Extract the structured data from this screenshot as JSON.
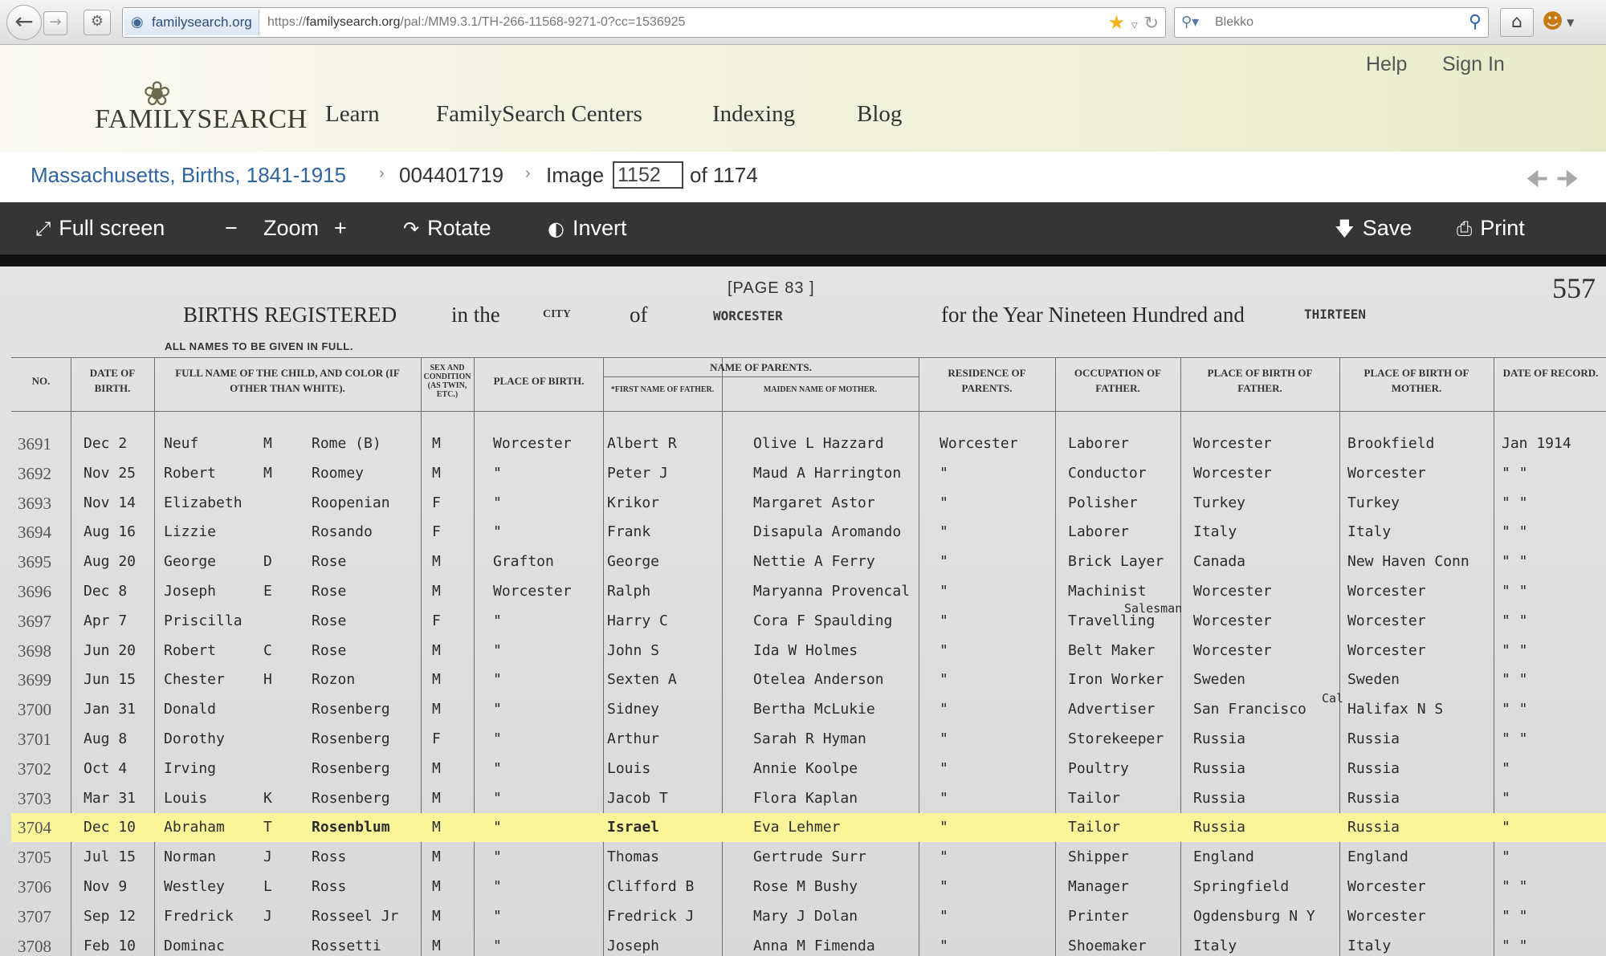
{
  "browser": {
    "site_identity": "familysearch.org",
    "url_prefix": "https://",
    "url_domain": "familysearch.org",
    "url_path": "/pal:/MM9.3.1/TH-266-11568-9271-0?cc=1536925",
    "search_placeholder": "Blekko",
    "icons": {
      "back": "back-arrow-icon",
      "forward": "forward-arrow-icon",
      "star": "bookmark-star-icon",
      "reload": "reload-icon",
      "home": "home-icon"
    }
  },
  "header": {
    "logo": "FAMILYSEARCH",
    "nav": [
      "Learn",
      "FamilySearch Centers",
      "Indexing",
      "Blog"
    ],
    "help": "Help",
    "sign_in": "Sign In"
  },
  "breadcrumb": {
    "collection": "Massachusetts, Births, 1841-1915",
    "film": "004401719",
    "image_label": "Image",
    "image_number": "1152",
    "of_label": "of 1174"
  },
  "toolbar": {
    "full_screen": "Full screen",
    "zoom_minus": "−",
    "zoom": "Zoom",
    "zoom_plus": "+",
    "rotate": "Rotate",
    "invert": "Invert",
    "save": "Save",
    "print": "Print"
  },
  "document": {
    "page_label": "[PAGE 83 ]",
    "page_number": "557",
    "title_part1": "BIRTHS REGISTERED",
    "title_in_the": "in the",
    "title_city": "CITY",
    "title_of": "of",
    "title_place": "WORCESTER",
    "title_year": "for the Year Nineteen Hundred and",
    "title_year_fill": "THIRTEEN",
    "subnote": "ALL NAMES TO BE GIVEN IN FULL.",
    "headers": {
      "no": "No.",
      "date_of_birth": "Date of Birth.",
      "full_name": "Full name of the child, and color (if other than white).",
      "sex": "Sex and condition (as Twin, etc.)",
      "place_of_birth": "Place of Birth.",
      "name_of_parents": "Name of Parents.",
      "father_first": "*First Name of Father.",
      "mother_maiden": "Maiden Name of Mother.",
      "residence": "Residence of Parents.",
      "occupation": "Occupation of Father.",
      "birthplace_father": "Place of Birth of Father.",
      "birthplace_mother": "Place of Birth of Mother.",
      "date_of_record": "Date of Record."
    },
    "rows": [
      {
        "no": "3691",
        "date": "Dec  2",
        "first": "Neuf",
        "mid": "M",
        "last": "Rome    (B)",
        "sex": "M",
        "place": "Worcester",
        "father": "Albert R",
        "mother": "Olive L Hazzard",
        "res": "Worcester",
        "occ": "Laborer",
        "bpf": "Worcester",
        "bpm": "Brookfield",
        "rec": "Jan 1914"
      },
      {
        "no": "3692",
        "date": "Nov 25",
        "first": "Robert",
        "mid": "M",
        "last": "Roomey",
        "sex": "M",
        "place": "\"",
        "father": "Peter J",
        "mother": "Maud A Harrington",
        "res": "\"",
        "occ": "Conductor",
        "bpf": "Worcester",
        "bpm": "Worcester",
        "rec": "\"  \""
      },
      {
        "no": "3693",
        "date": "Nov 14",
        "first": "Elizabeth",
        "mid": "",
        "last": "Roopenian",
        "sex": "F",
        "place": "\"",
        "father": "Krikor",
        "mother": "Margaret Astor",
        "res": "\"",
        "occ": "Polisher",
        "bpf": "Turkey",
        "bpm": "Turkey",
        "rec": "\"  \""
      },
      {
        "no": "3694",
        "date": "Aug 16",
        "first": "Lizzie",
        "mid": "",
        "last": "Rosando",
        "sex": "F",
        "place": "\"",
        "father": "Frank",
        "mother": "Disapula Aromando",
        "res": "\"",
        "occ": "Laborer",
        "bpf": "Italy",
        "bpm": "Italy",
        "rec": "\"  \""
      },
      {
        "no": "3695",
        "date": "Aug 20",
        "first": "George",
        "mid": "D",
        "last": "Rose",
        "sex": "M",
        "place": "Grafton",
        "father": "George",
        "mother": "Nettie A Ferry",
        "res": "\"",
        "occ": "Brick Layer",
        "bpf": "Canada",
        "bpm": "New Haven Conn",
        "rec": "\"  \""
      },
      {
        "no": "3696",
        "date": "Dec  8",
        "first": "Joseph",
        "mid": "E",
        "last": "Rose",
        "sex": "M",
        "place": "Worcester",
        "father": "Ralph",
        "mother": "Maryanna Provencal",
        "res": "\"",
        "occ": "Machinist",
        "bpf": "Worcester",
        "bpm": "Worcester",
        "rec": "\"  \""
      },
      {
        "no": "3697",
        "date": "Apr  7",
        "first": "Priscilla",
        "mid": "",
        "last": "Rose",
        "sex": "F",
        "place": "\"",
        "father": "Harry C",
        "mother": "Cora F Spaulding",
        "res": "\"",
        "occ": "Travelling",
        "occ_note": "Salesman",
        "bpf": "Worcester",
        "bpm": "Worcester",
        "rec": "\"  \""
      },
      {
        "no": "3698",
        "date": "Jun 20",
        "first": "Robert",
        "mid": "C",
        "last": "Rose",
        "sex": "M",
        "place": "\"",
        "father": "John S",
        "mother": "Ida W Holmes",
        "res": "\"",
        "occ": "Belt Maker",
        "bpf": "Worcester",
        "bpm": "Worcester",
        "rec": "\"  \""
      },
      {
        "no": "3699",
        "date": "Jun 15",
        "first": "Chester",
        "mid": "H",
        "last": "Rozon",
        "sex": "M",
        "place": "\"",
        "father": "Sexten A",
        "mother": "Otelea Anderson",
        "res": "\"",
        "occ": "Iron Worker",
        "bpf": "Sweden",
        "bpm": "Sweden",
        "rec": "\"  \""
      },
      {
        "no": "3700",
        "date": "Jan 31",
        "first": "Donald",
        "mid": "",
        "last": "Rosenberg",
        "sex": "M",
        "place": "\"",
        "father": "Sidney",
        "mother": "Bertha McLukie",
        "res": "\"",
        "occ": "Advertiser",
        "bpf": "San Francisco",
        "bpf_note": "Cal",
        "bpm": "Halifax N S",
        "rec": "\"  \""
      },
      {
        "no": "3701",
        "date": "Aug  8",
        "first": "Dorothy",
        "mid": "",
        "last": "Rosenberg",
        "sex": "F",
        "place": "\"",
        "father": "Arthur",
        "mother": "Sarah R Hyman",
        "res": "\"",
        "occ": "Storekeeper",
        "bpf": "Russia",
        "bpm": "Russia",
        "rec": "\"  \""
      },
      {
        "no": "3702",
        "date": "Oct  4",
        "first": "Irving",
        "mid": "",
        "last": "Rosenberg",
        "sex": "M",
        "place": "\"",
        "father": "Louis",
        "mother": "Annie Koolpe",
        "res": "\"",
        "occ": "Poultry",
        "bpf": "Russia",
        "bpm": "Russia",
        "rec": "\""
      },
      {
        "no": "3703",
        "date": "Mar 31",
        "first": "Louis",
        "mid": "K",
        "last": "Rosenberg",
        "sex": "M",
        "place": "\"",
        "father": "Jacob T",
        "mother": "Flora Kaplan",
        "res": "\"",
        "occ": "Tailor",
        "bpf": "Russia",
        "bpm": "Russia",
        "rec": "\""
      },
      {
        "no": "3704",
        "date": "Dec 10",
        "first": "Abraham",
        "mid": "T",
        "last": "Rosenblum",
        "sex": "M",
        "place": "\"",
        "father": "Israel",
        "mother": "Eva Lehmer",
        "res": "\"",
        "occ": "Tailor",
        "bpf": "Russia",
        "bpm": "Russia",
        "rec": "\"",
        "highlight": true
      },
      {
        "no": "3705",
        "date": "Jul 15",
        "first": "Norman",
        "mid": "J",
        "last": "Ross",
        "sex": "M",
        "place": "\"",
        "father": "Thomas",
        "mother": "Gertrude Surr",
        "res": "\"",
        "occ": "Shipper",
        "bpf": "England",
        "bpm": "England",
        "rec": "\""
      },
      {
        "no": "3706",
        "date": "Nov  9",
        "first": "Westley",
        "mid": "L",
        "last": "Ross",
        "sex": "M",
        "place": "\"",
        "father": "Clifford B",
        "mother": "Rose M Bushy",
        "res": "\"",
        "occ": "Manager",
        "bpf": "Springfield",
        "bpm": "Worcester",
        "rec": "\"  \""
      },
      {
        "no": "3707",
        "date": "Sep 12",
        "first": "Fredrick",
        "mid": "J",
        "last": "Rosseel Jr",
        "sex": "M",
        "place": "\"",
        "father": "Fredrick J",
        "mother": "Mary J Dolan",
        "res": "\"",
        "occ": "Printer",
        "bpf": "Ogdensburg N Y",
        "bpm": "Worcester",
        "rec": "\"  \""
      },
      {
        "no": "3708",
        "date": "Feb 10",
        "first": "Dominac",
        "mid": "",
        "last": "Rossetti",
        "sex": "M",
        "place": "\"",
        "father": "Joseph",
        "mother": "Anna M Fimenda",
        "res": "\"",
        "occ": "Shoemaker",
        "bpf": "Italy",
        "bpm": "Italy",
        "rec": "\"  \""
      }
    ]
  },
  "colors": {
    "toolbar_bg": "#353535",
    "link": "#2f64a3",
    "highlight": "#fbf59a"
  }
}
